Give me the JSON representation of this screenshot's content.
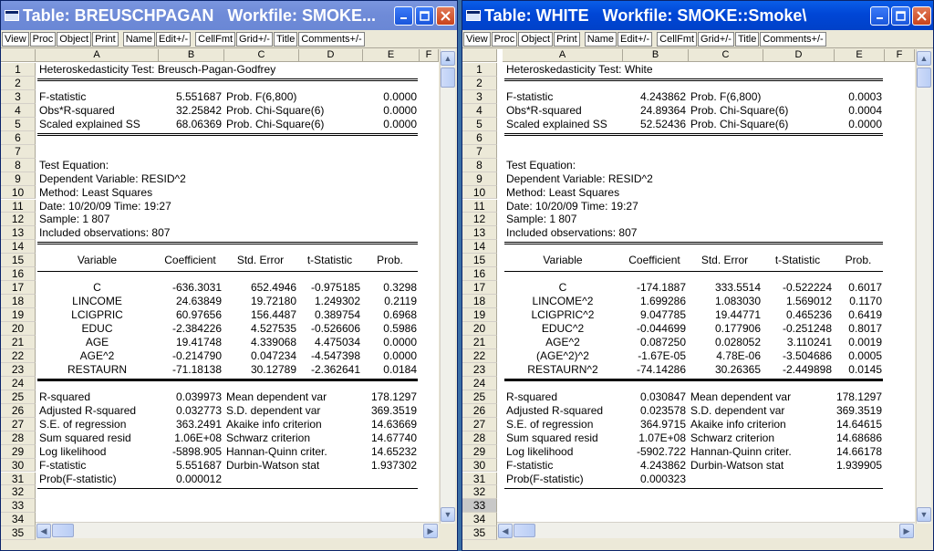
{
  "windows": [
    {
      "title": "Table: BREUSCHPAGAN   Workfile: SMOKE...",
      "toolbar": [
        "View",
        "Proc",
        "Object",
        "Print",
        "Name",
        "Edit+/-",
        "CellFmt",
        "Grid+/-",
        "Title",
        "Comments+/-"
      ],
      "columns": [
        "A",
        "B",
        "C",
        "D",
        "E",
        "F"
      ],
      "row_count": 35,
      "rows": {
        "1": {
          "A": "Heteroskedasticity Test: Breusch-Pagan-Godfrey"
        },
        "3": {
          "A": "F-statistic",
          "B": "5.551687",
          "C": "Prob. F(6,800)",
          "E": "0.0000"
        },
        "4": {
          "A": "Obs*R-squared",
          "B": "32.25842",
          "C": "Prob. Chi-Square(6)",
          "E": "0.0000"
        },
        "5": {
          "A": "Scaled explained SS",
          "B": "68.06369",
          "C": "Prob. Chi-Square(6)",
          "E": "0.0000"
        },
        "8": {
          "A": "Test Equation:"
        },
        "9": {
          "A": "Dependent Variable: RESID^2"
        },
        "10": {
          "A": "Method: Least Squares"
        },
        "11": {
          "A": "Date: 10/20/09   Time: 19:27"
        },
        "12": {
          "A": "Sample: 1 807"
        },
        "13": {
          "A": "Included observations: 807"
        },
        "15": {
          "A": "Variable",
          "B": "Coefficient",
          "C": "Std. Error",
          "D": "t-Statistic",
          "E": "Prob."
        },
        "17": {
          "A": "C",
          "B": "-636.3031",
          "C": "652.4946",
          "D": "-0.975185",
          "E": "0.3298"
        },
        "18": {
          "A": "LINCOME",
          "B": "24.63849",
          "C": "19.72180",
          "D": "1.249302",
          "E": "0.2119"
        },
        "19": {
          "A": "LCIGPRIC",
          "B": "60.97656",
          "C": "156.4487",
          "D": "0.389754",
          "E": "0.6968"
        },
        "20": {
          "A": "EDUC",
          "B": "-2.384226",
          "C": "4.527535",
          "D": "-0.526606",
          "E": "0.5986"
        },
        "21": {
          "A": "AGE",
          "B": "19.41748",
          "C": "4.339068",
          "D": "4.475034",
          "E": "0.0000"
        },
        "22": {
          "A": "AGE^2",
          "B": "-0.214790",
          "C": "0.047234",
          "D": "-4.547398",
          "E": "0.0000"
        },
        "23": {
          "A": "RESTAURN",
          "B": "-71.18138",
          "C": "30.12789",
          "D": "-2.362641",
          "E": "0.0184"
        },
        "25": {
          "A": "R-squared",
          "B": "0.039973",
          "C": "Mean dependent var",
          "E": "178.1297"
        },
        "26": {
          "A": "Adjusted R-squared",
          "B": "0.032773",
          "C": "S.D. dependent var",
          "E": "369.3519"
        },
        "27": {
          "A": "S.E. of regression",
          "B": "363.2491",
          "C": "Akaike info criterion",
          "E": "14.63669"
        },
        "28": {
          "A": "Sum squared resid",
          "B": "1.06E+08",
          "C": "Schwarz criterion",
          "E": "14.67740"
        },
        "29": {
          "A": "Log likelihood",
          "B": "-5898.905",
          "C": "Hannan-Quinn criter.",
          "E": "14.65232"
        },
        "30": {
          "A": "F-statistic",
          "B": "5.551687",
          "C": "Durbin-Watson stat",
          "E": "1.937302"
        },
        "31": {
          "A": "Prob(F-statistic)",
          "B": "0.000012"
        }
      }
    },
    {
      "title": "Table: WHITE   Workfile: SMOKE::Smoke\\",
      "toolbar": [
        "View",
        "Proc",
        "Object",
        "Print",
        "Name",
        "Edit+/-",
        "CellFmt",
        "Grid+/-",
        "Title",
        "Comments+/-"
      ],
      "columns": [
        "A",
        "B",
        "C",
        "D",
        "E",
        "F"
      ],
      "row_count": 35,
      "selected_row": "33",
      "rows": {
        "1": {
          "A": "Heteroskedasticity Test: White"
        },
        "3": {
          "A": "F-statistic",
          "B": "4.243862",
          "C": "Prob. F(6,800)",
          "E": "0.0003"
        },
        "4": {
          "A": "Obs*R-squared",
          "B": "24.89364",
          "C": "Prob. Chi-Square(6)",
          "E": "0.0004"
        },
        "5": {
          "A": "Scaled explained SS",
          "B": "52.52436",
          "C": "Prob. Chi-Square(6)",
          "E": "0.0000"
        },
        "8": {
          "A": "Test Equation:"
        },
        "9": {
          "A": "Dependent Variable: RESID^2"
        },
        "10": {
          "A": "Method: Least Squares"
        },
        "11": {
          "A": "Date: 10/20/09   Time: 19:27"
        },
        "12": {
          "A": "Sample: 1 807"
        },
        "13": {
          "A": "Included observations: 807"
        },
        "15": {
          "A": "Variable",
          "B": "Coefficient",
          "C": "Std. Error",
          "D": "t-Statistic",
          "E": "Prob."
        },
        "17": {
          "A": "C",
          "B": "-174.1887",
          "C": "333.5514",
          "D": "-0.522224",
          "E": "0.6017"
        },
        "18": {
          "A": "LINCOME^2",
          "B": "1.699286",
          "C": "1.083030",
          "D": "1.569012",
          "E": "0.1170"
        },
        "19": {
          "A": "LCIGPRIC^2",
          "B": "9.047785",
          "C": "19.44771",
          "D": "0.465236",
          "E": "0.6419"
        },
        "20": {
          "A": "EDUC^2",
          "B": "-0.044699",
          "C": "0.177906",
          "D": "-0.251248",
          "E": "0.8017"
        },
        "21": {
          "A": "AGE^2",
          "B": "0.087250",
          "C": "0.028052",
          "D": "3.110241",
          "E": "0.0019"
        },
        "22": {
          "A": "(AGE^2)^2",
          "B": "-1.67E-05",
          "C": "4.78E-06",
          "D": "-3.504686",
          "E": "0.0005"
        },
        "23": {
          "A": "RESTAURN^2",
          "B": "-74.14286",
          "C": "30.26365",
          "D": "-2.449898",
          "E": "0.0145"
        },
        "25": {
          "A": "R-squared",
          "B": "0.030847",
          "C": "Mean dependent var",
          "E": "178.1297"
        },
        "26": {
          "A": "Adjusted R-squared",
          "B": "0.023578",
          "C": "S.D. dependent var",
          "E": "369.3519"
        },
        "27": {
          "A": "S.E. of regression",
          "B": "364.9715",
          "C": "Akaike info criterion",
          "E": "14.64615"
        },
        "28": {
          "A": "Sum squared resid",
          "B": "1.07E+08",
          "C": "Schwarz criterion",
          "E": "14.68686"
        },
        "29": {
          "A": "Log likelihood",
          "B": "-5902.722",
          "C": "Hannan-Quinn criter.",
          "E": "14.66178"
        },
        "30": {
          "A": "F-statistic",
          "B": "4.243862",
          "C": "Durbin-Watson stat",
          "E": "1.939905"
        },
        "31": {
          "A": "Prob(F-statistic)",
          "B": "0.000323"
        }
      }
    }
  ]
}
